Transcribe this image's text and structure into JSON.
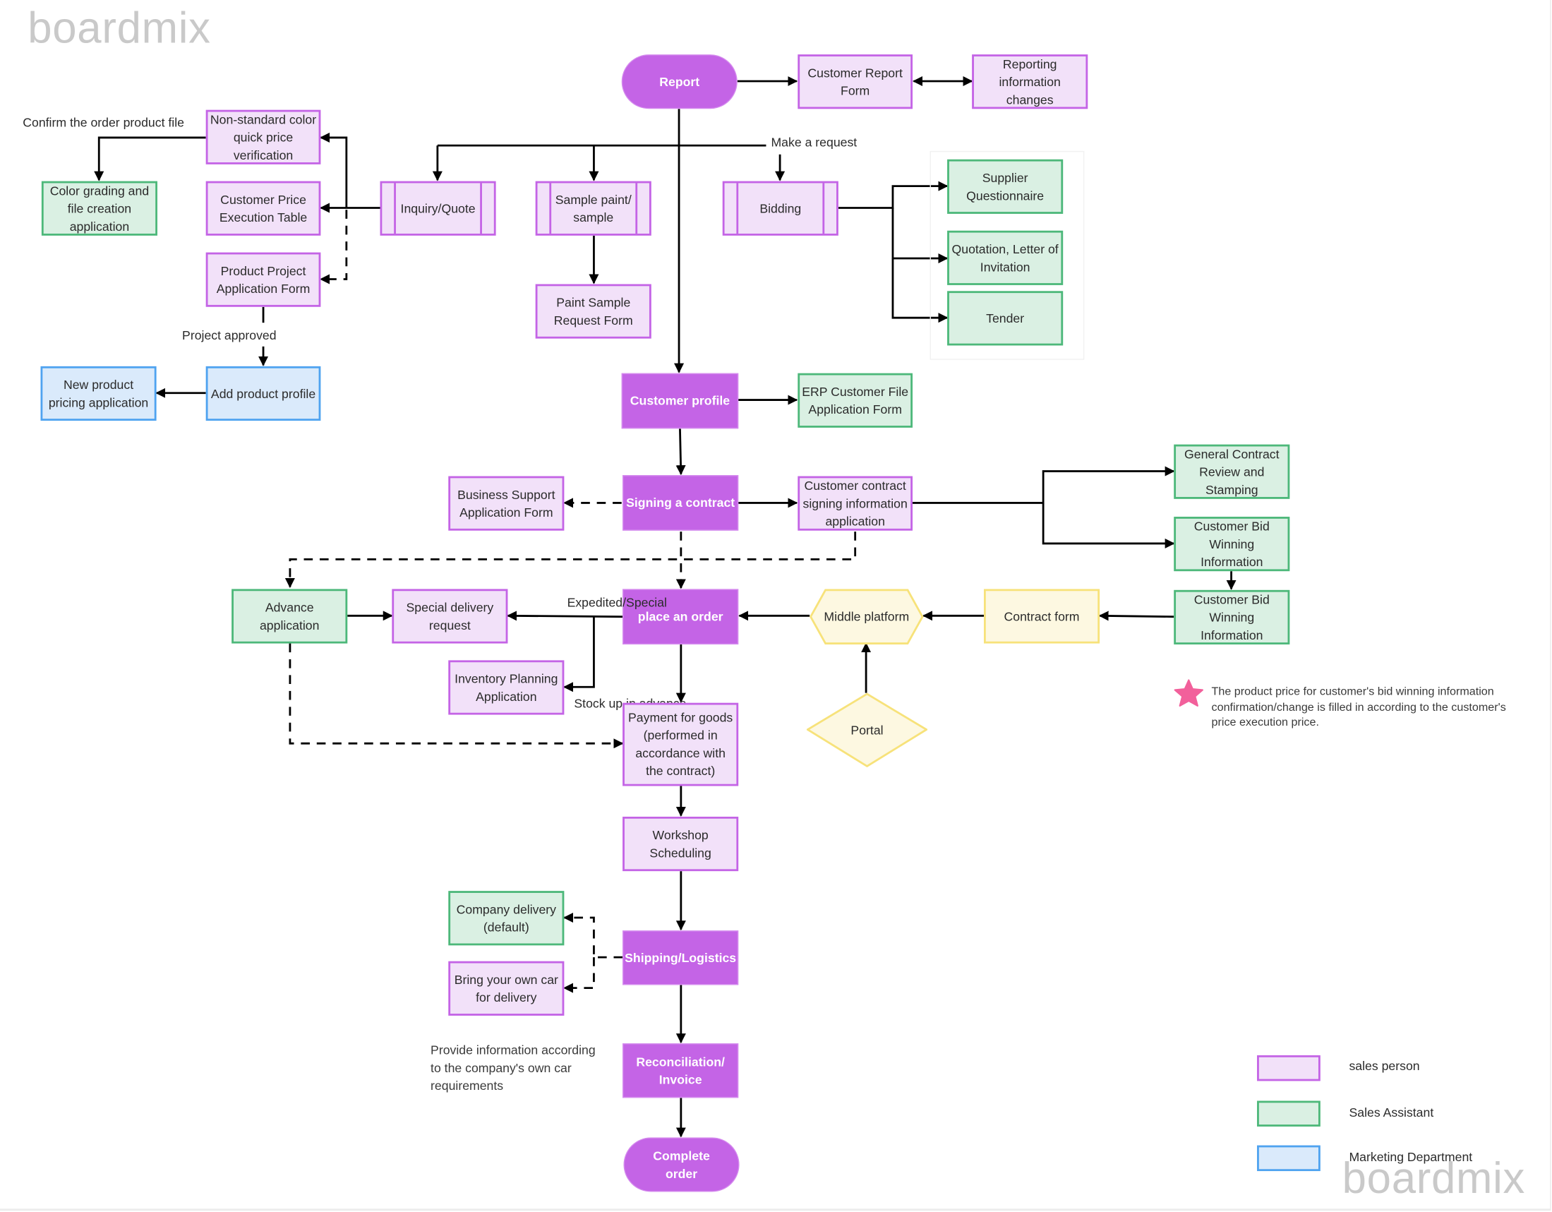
{
  "watermark": {
    "top": "boardmix",
    "bottom": "boardmix"
  },
  "colors": {
    "main_fill": "#C464E6",
    "sales_person_fill": "#F2E1F9",
    "sales_person_border": "#C464E6",
    "sales_assistant_fill": "#DAF0E3",
    "sales_assistant_border": "#4DB87A",
    "marketing_fill": "#DAEAFB",
    "marketing_border": "#4FA3F0",
    "system_fill": "#FDF8E1",
    "system_border": "#F7E27A",
    "star": "#F2609B"
  },
  "nodes": {
    "report": "Report",
    "customer_report_form": "Customer Report Form",
    "reporting_info_changes": "Reporting information changes",
    "inquiry_quote": "Inquiry/Quote",
    "sample_paint": "Sample paint/ sample",
    "bidding": "Bidding",
    "non_standard_color": "Non-standard color quick price verification",
    "customer_price_table": "Customer Price Execution Table",
    "product_project_form": "Product Project Application Form",
    "color_grading": "Color grading and file creation application",
    "add_product_profile": "Add product profile",
    "new_product_pricing": "New product pricing application",
    "paint_sample_form": "Paint Sample Request Form",
    "supplier_questionnaire": "Supplier Questionnaire",
    "quotation_letter": "Quotation, Letter of Invitation",
    "tender": "Tender",
    "customer_profile": "Customer profile",
    "erp_customer_file": "ERP Customer File Application Form",
    "signing_contract": "Signing a contract",
    "business_support": "Business Support Application Form",
    "contract_signing_info": "Customer contract signing information application",
    "general_contract_review": "General Contract Review and Stamping",
    "customer_bid_winning_1": "Customer Bid Winning Information",
    "customer_bid_winning_2": "Customer Bid Winning Information",
    "contract_form": "Contract form",
    "middle_platform": "Middle platform",
    "portal": "Portal",
    "place_order": "place an order",
    "advance_application": "Advance application",
    "special_delivery": "Special delivery request",
    "inventory_planning": "Inventory Planning Application",
    "payment_for_goods": "Payment for goods (performed in accordance with the contract)",
    "workshop_scheduling": "Workshop Scheduling",
    "shipping_logistics": "Shipping/Logistics",
    "company_delivery": "Company delivery (default)",
    "own_car_delivery": "Bring your own car for delivery",
    "reconciliation_invoice": "Reconciliation/ Invoice",
    "complete_order": "Complete order"
  },
  "edge_labels": {
    "confirm_order_file": "Confirm the order product file",
    "make_request": "Make a request",
    "project_approved": "Project approved",
    "expedited_special": "Expedited/Special",
    "stock_up": "Stock up in advance"
  },
  "notes": {
    "star_note": "The product price for customer's bid winning information confirmation/change is filled in according to the customer's price execution price.",
    "own_car_note": "Provide information according to the company's own car requirements"
  },
  "legend": [
    {
      "label": "sales person",
      "role": "sales_person"
    },
    {
      "label": "Sales Assistant",
      "role": "sales_assistant"
    },
    {
      "label": "Marketing Department",
      "role": "marketing"
    }
  ]
}
